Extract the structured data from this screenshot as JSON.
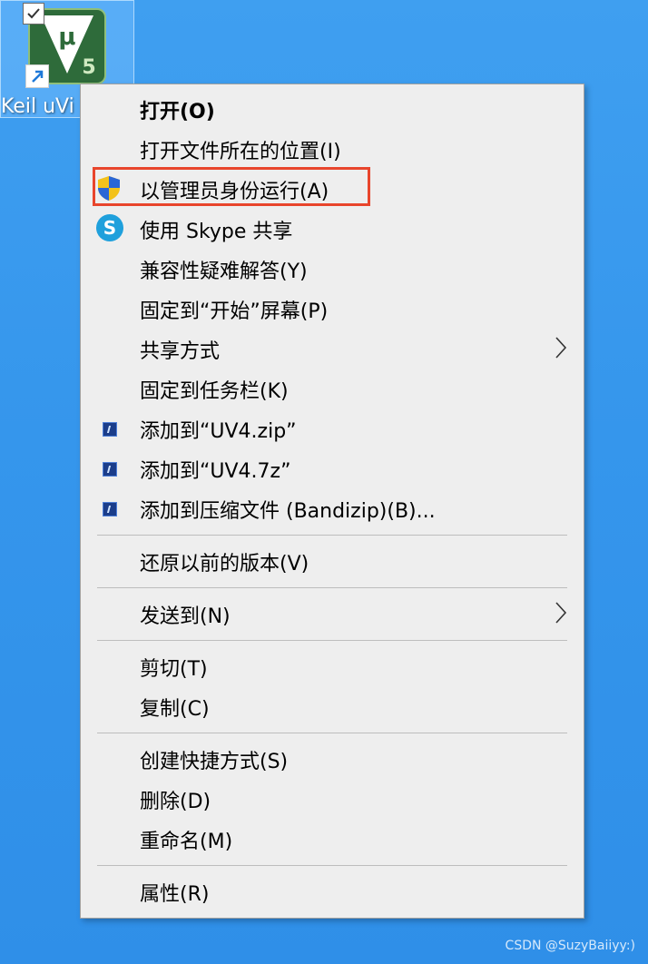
{
  "desktop": {
    "icon_label": "Keil uVi",
    "logo_text": "μ",
    "logo_number": "5"
  },
  "menu": {
    "items": [
      {
        "label": "打开(O)"
      },
      {
        "label": "打开文件所在的位置(I)"
      },
      {
        "label": "以管理员身份运行(A)",
        "icon": "uac-shield-icon"
      },
      {
        "label": "使用 Skype 共享",
        "icon": "skype-icon"
      },
      {
        "label": "兼容性疑难解答(Y)"
      },
      {
        "label": "固定到“开始”屏幕(P)"
      },
      {
        "label": "共享方式",
        "submenu": true
      },
      {
        "label": "固定到任务栏(K)"
      },
      {
        "label": "添加到“UV4.zip”",
        "icon": "bandizip-icon"
      },
      {
        "label": "添加到“UV4.7z”",
        "icon": "bandizip-icon"
      },
      {
        "label": "添加到压缩文件 (Bandizip)(B)...",
        "icon": "bandizip-icon"
      },
      {
        "label": "还原以前的版本(V)"
      },
      {
        "label": "发送到(N)",
        "submenu": true
      },
      {
        "label": "剪切(T)"
      },
      {
        "label": "复制(C)"
      },
      {
        "label": "创建快捷方式(S)"
      },
      {
        "label": "删除(D)"
      },
      {
        "label": "重命名(M)"
      },
      {
        "label": "属性(R)"
      }
    ],
    "highlight_color": "#e8452c"
  },
  "watermark": "CSDN @SuzyBaiiyy:)"
}
